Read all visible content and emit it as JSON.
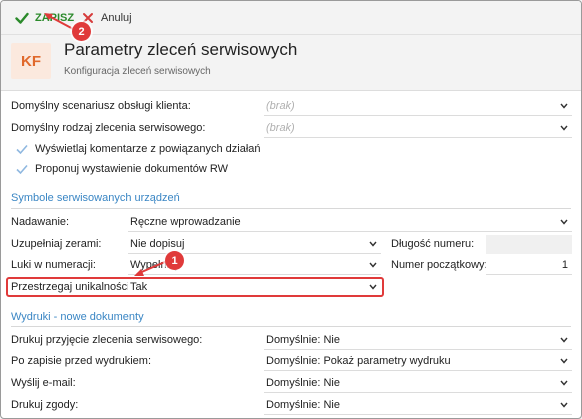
{
  "toolbar": {
    "save_label": "ZAPISZ",
    "cancel_label": "Anuluj"
  },
  "header": {
    "logo_text": "KF",
    "title": "Parametry zleceń serwisowych",
    "subtitle": "Konfiguracja zleceń serwisowych"
  },
  "general": {
    "scenario_label": "Domyślny scenariusz obsługi klienta:",
    "scenario_value": "(brak)",
    "order_type_label": "Domyślny rodzaj zlecenia serwisowego:",
    "order_type_value": "(brak)",
    "comments_label": "Wyświetlaj komentarze z powiązanych działań",
    "rw_label": "Proponuj wystawienie dokumentów RW"
  },
  "symbols": {
    "section_title": "Symbole serwisowanych urządzeń",
    "assign_label": "Nadawanie:",
    "assign_value": "Ręczne wprowadzanie",
    "zeros_label": "Uzupełniaj zerami:",
    "zeros_value": "Nie dopisuj",
    "length_label": "Długość numeru:",
    "length_value": "",
    "gaps_label": "Luki w numeracji:",
    "gaps_value": "Wypełniaj",
    "start_label": "Numer początkowy:",
    "start_value": "1",
    "unique_label": "Przestrzegaj unikalności:",
    "unique_value": "Tak"
  },
  "printouts": {
    "section_title": "Wydruki - nowe dokumenty",
    "receipt_label": "Drukuj przyjęcie zlecenia serwisowego:",
    "receipt_value": "Domyślnie: Nie",
    "after_save_label": "Po zapisie przed wydrukiem:",
    "after_save_value": "Domyślnie: Pokaż parametry wydruku",
    "email_label": "Wyślij e-mail:",
    "email_value": "Domyślnie: Nie",
    "consent_label": "Drukuj zgody:",
    "consent_value": "Domyślnie: Nie"
  },
  "callouts": {
    "step1": "1",
    "step2": "2"
  },
  "colors": {
    "save_green": "#2b8a2b",
    "cancel_red": "#d63b3b",
    "accent_blue": "#3a86c4",
    "logo_orange": "#e0692c",
    "callout_red": "#e03a3a"
  }
}
